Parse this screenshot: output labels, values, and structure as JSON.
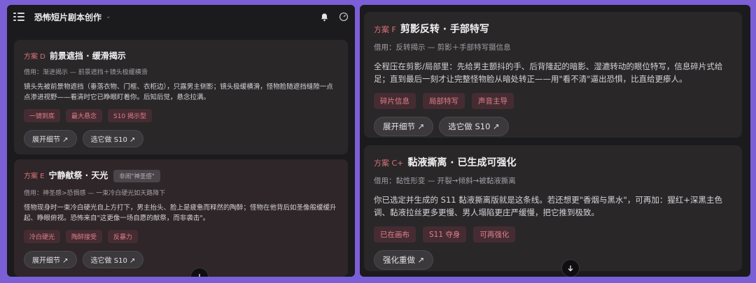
{
  "header": {
    "title": "恐怖短片剧本创作"
  },
  "left": {
    "card_d": {
      "tag": "方案 D",
      "title": "前景遮挡 · 缓滑揭示",
      "sub": "借用：渐进揭示 — 前景遮挡＋镜头极缓横滑",
      "body": "镜头先被前景物遮挡（垂落衣物、门框、衣柜边），只露男主侧影；镜头极缓横滑，怪物脸随遮挡缝隙一点点渗进视野——看清时它已睁眼盯着你。后知后觉，悬念拉满。",
      "chips": [
        "一镜到底",
        "最大悬念",
        "S10 揭示型"
      ],
      "buttons": [
        "展开细节 ↗",
        "选它做 S10 ↗"
      ]
    },
    "card_e": {
      "tag": "方案 E",
      "title": "宁静献祭 · 天光",
      "badge": "非闹\"神圣感\"",
      "sub": "借用：神圣感>恐惧感 — 一束冷白硬光如天路降下",
      "body": "怪物现身时一束冷白硬光自上方打下，男主抬头、脸上是疲惫而释然的陶醉；怪物在他背后如圣像般缓缓升起、睁眼俯视。恐怖来自\"这更像一场自愿的献祭，而非袭击\"。",
      "chips": [
        "冷白硬光",
        "陶醉接受",
        "反暴力"
      ],
      "buttons": [
        "展开细节 ↗",
        "选它做 S10 ↗"
      ]
    }
  },
  "right": {
    "card_f": {
      "tag": "方案 F",
      "title": "剪影反转 · 手部特写",
      "sub": "借用：反转揭示 — 剪影＋手部特写摄信息",
      "body": "全程压在剪影/局部里：先给男主颤抖的手、后背隆起的暗影、湿漉转动的眼位特写，信息碎片式给足；直到最后一刻才让完整怪物脸从暗处转正——用\"看不清\"逼出恐惧，比直给更瘆人。",
      "chips": [
        "碎片信息",
        "局部特写",
        "声音主导"
      ],
      "buttons": [
        "展开细节 ↗",
        "选它做 S10 ↗"
      ]
    },
    "card_c": {
      "tag": "方案 C+",
      "title": "黏液撕离 · 已生成可强化",
      "sub": "借用：黏性形变 — 开裂→倾斜→被黏液撕离",
      "body": "你已选定并生成的 S11 黏液撕离版就是这条线。若还想更\"香烟与黑水\"，可再加：猩红+深黑主色调、黏液拉丝更多更慢、男人塌陷更庄严缓慢，把它推到极致。",
      "chips": [
        "已在画布",
        "S11 夺身",
        "可再强化"
      ],
      "buttons": [
        "强化重做 ↗"
      ]
    }
  },
  "colors": {
    "accent": "#d9727a",
    "panel": "#1b1a1d",
    "frame": "#7b5fd6"
  },
  "icons": [
    "menu-icon",
    "chevron-down-icon",
    "bell-icon",
    "gauge-icon",
    "arrow-down-icon"
  ]
}
